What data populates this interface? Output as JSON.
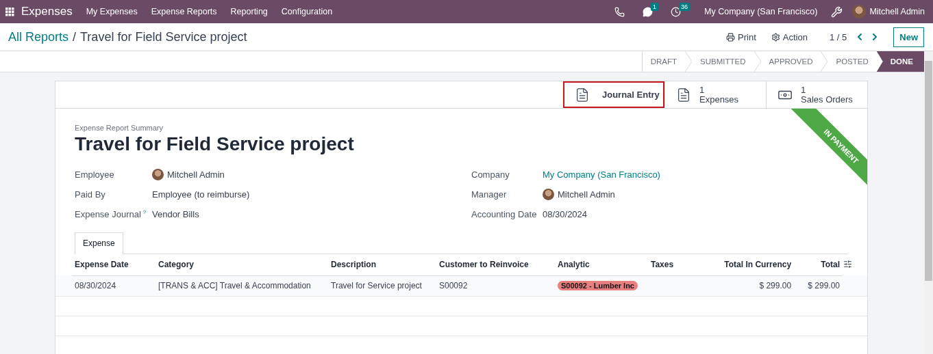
{
  "navbar": {
    "app_name": "Expenses",
    "menu": [
      "My Expenses",
      "Expense Reports",
      "Reporting",
      "Configuration"
    ],
    "messages_count": "1",
    "activities_count": "36",
    "company": "My Company (San Francisco)",
    "user": "Mitchell Admin"
  },
  "breadcrumb": {
    "parent": "All Reports",
    "separator": "/",
    "current": "Travel for Field Service project"
  },
  "actions": {
    "print": "Print",
    "action": "Action",
    "pager": "1 / 5",
    "new": "New"
  },
  "stages": [
    {
      "label": "DRAFT",
      "selected": false
    },
    {
      "label": "SUBMITTED",
      "selected": false
    },
    {
      "label": "APPROVED",
      "selected": false
    },
    {
      "label": "POSTED",
      "selected": false
    },
    {
      "label": "DONE",
      "selected": true
    }
  ],
  "smart_buttons": [
    {
      "kind": "document",
      "label": "Journal Entry",
      "highlighted": true
    },
    {
      "kind": "document",
      "value": "1",
      "label": "Expenses",
      "highlighted": false
    },
    {
      "kind": "money",
      "value": "1",
      "label": "Sales Orders",
      "highlighted": false
    }
  ],
  "ribbon": "IN PAYMENT",
  "form": {
    "subtitle": "Expense Report Summary",
    "title": "Travel for Field Service project",
    "left_fields": [
      {
        "label": "Employee",
        "value": "Mitchell Admin",
        "kind": "avatar"
      },
      {
        "label": "Paid By",
        "value": "Employee (to reimburse)",
        "kind": "text"
      },
      {
        "label": "Expense Journal",
        "help": "?",
        "value": "Vendor Bills",
        "kind": "text"
      }
    ],
    "right_fields": [
      {
        "label": "Company",
        "value": "My Company (San Francisco)",
        "kind": "link"
      },
      {
        "label": "Manager",
        "value": "Mitchell Admin",
        "kind": "avatar"
      },
      {
        "label": "Accounting Date",
        "value": "08/30/2024",
        "kind": "text"
      }
    ]
  },
  "tabs": [
    {
      "label": "Expense",
      "selected": true
    }
  ],
  "table": {
    "columns": [
      "Expense Date",
      "Category",
      "Description",
      "Customer to Reinvoice",
      "Analytic",
      "Taxes",
      "Total In Currency",
      "Total"
    ],
    "rows": [
      {
        "expense_date": "08/30/2024",
        "category": "[TRANS & ACC] Travel & Accommodation",
        "description": "Travel for Service project",
        "customer": "S00092",
        "analytic": {
          "label": "S00092 - Lumber Inc",
          "color": "#e88080"
        },
        "total_in_currency": "$ 299.00",
        "total": "$ 299.00"
      }
    ]
  }
}
